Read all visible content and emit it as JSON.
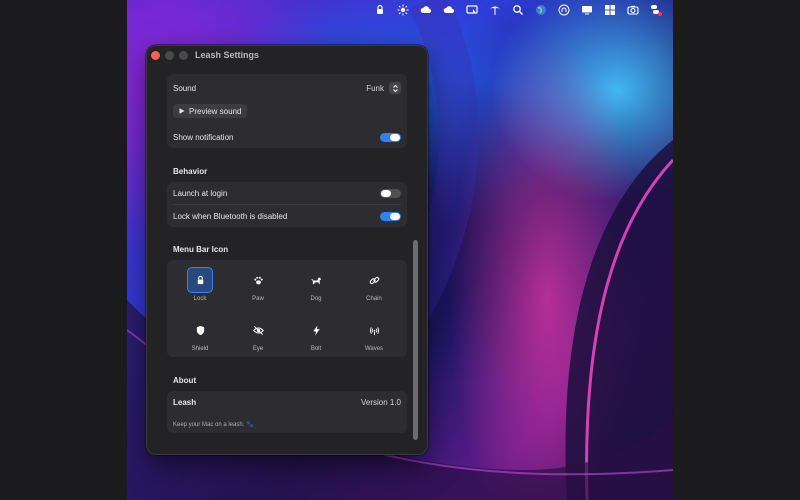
{
  "window": {
    "title": "Leash Settings"
  },
  "notifications": {
    "sound_label": "Sound",
    "sound_value": "Funk",
    "preview_label": "Preview sound",
    "show_notification_label": "Show notification",
    "show_notification_on": true
  },
  "behavior": {
    "title": "Behavior",
    "launch_label": "Launch at login",
    "launch_on": false,
    "lock_bt_label": "Lock when Bluetooth is disabled",
    "lock_bt_on": true
  },
  "menu_bar_icon": {
    "title": "Menu Bar Icon",
    "selected": "Lock",
    "options": [
      {
        "label": "Lock",
        "icon": "lock-icon"
      },
      {
        "label": "Paw",
        "icon": "paw-icon"
      },
      {
        "label": "Dog",
        "icon": "dog-icon"
      },
      {
        "label": "Chain",
        "icon": "chain-icon"
      },
      {
        "label": "Shield",
        "icon": "shield-icon"
      },
      {
        "label": "Eye",
        "icon": "eye-icon"
      },
      {
        "label": "Bolt",
        "icon": "bolt-icon"
      },
      {
        "label": "Waves",
        "icon": "waves-icon"
      }
    ]
  },
  "about": {
    "title": "About",
    "app_name": "Leash",
    "version": "Version 1.0",
    "tagline": "Keep your Mac on a leash. 🐾"
  },
  "menubar": {
    "icons": [
      "lock-icon",
      "sun-icon",
      "cloud-icon",
      "cloud-icon",
      "display-icon",
      "palm-icon",
      "search-icon",
      "globe-icon",
      "siri-icon",
      "screen-icon",
      "grid-icon",
      "camera-icon",
      "control-center-icon"
    ]
  },
  "colors": {
    "accent": "#2f81f0",
    "window_bg": "#232326",
    "group_bg": "#2d2d31"
  }
}
